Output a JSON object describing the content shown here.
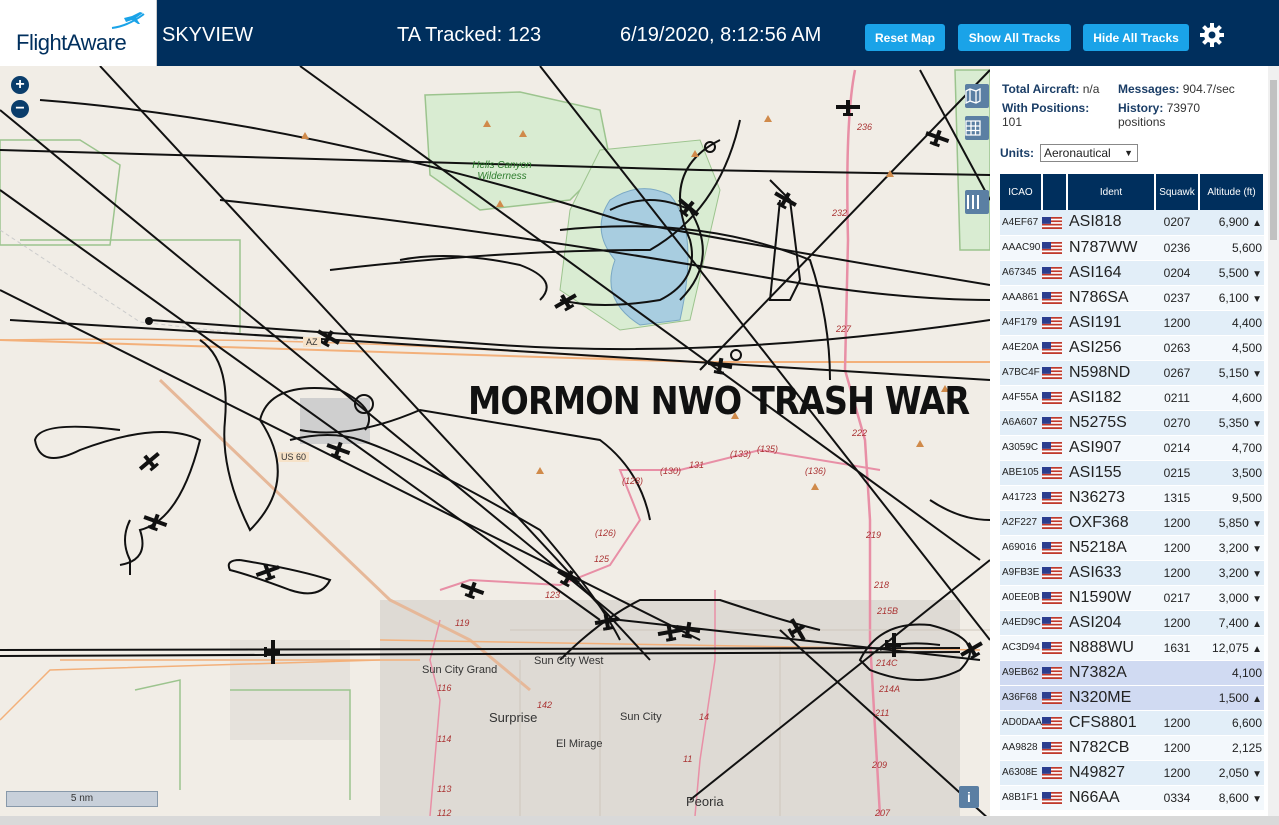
{
  "header": {
    "logo": "FlightAware",
    "app_name": "SKYVIEW",
    "tracked": "TA Tracked: 123",
    "datetime": "6/19/2020, 8:12:56 AM",
    "buttons": {
      "reset": "Reset Map",
      "show_all": "Show All Tracks",
      "hide_all": "Hide All Tracks"
    }
  },
  "map": {
    "overlay_text": "MORMON NWO TRASH WAR",
    "scale": "5 nm",
    "zoom_in": "+",
    "zoom_out": "−",
    "info": "i",
    "places": [
      "Hells Canyon",
      "Wilderness",
      "Sun City Grand",
      "Sun City West",
      "Surprise",
      "Sun City",
      "El Mirage",
      "Peoria",
      "AZ",
      "US 60"
    ],
    "route_labels": [
      "236",
      "232",
      "227",
      "222",
      "219",
      "218",
      "215B",
      "214C",
      "214A",
      "211",
      "209",
      "207",
      "131",
      "(133)",
      "(135)",
      "(136)",
      "(130)",
      "(128)",
      "(126)",
      "125",
      "123",
      "119",
      "116",
      "114",
      "113",
      "112",
      "142",
      "14",
      "11"
    ]
  },
  "panel": {
    "stats": {
      "total_aircraft_label": "Total Aircraft:",
      "total_aircraft": "n/a",
      "messages_label": "Messages:",
      "messages": "904.7/sec",
      "with_positions_label": "With Positions:",
      "with_positions": "101",
      "history_label": "History:",
      "history": "73970",
      "history_unit": "positions"
    },
    "units_label": "Units:",
    "units_value": "Aeronautical",
    "columns": [
      "ICAO",
      "",
      "Ident",
      "Squawk",
      "Altitude (ft)"
    ],
    "rows": [
      {
        "icao": "A4EF67",
        "ident": "ASI818",
        "squawk": "0207",
        "alt": "6,900",
        "trend": "▲",
        "pos": true
      },
      {
        "icao": "AAAC90",
        "ident": "N787WW",
        "squawk": "0236",
        "alt": "5,600",
        "trend": "",
        "pos": true
      },
      {
        "icao": "A67345",
        "ident": "ASI164",
        "squawk": "0204",
        "alt": "5,500",
        "trend": "▼",
        "pos": true
      },
      {
        "icao": "AAA861",
        "ident": "N786SA",
        "squawk": "0237",
        "alt": "6,100",
        "trend": "▼",
        "pos": true
      },
      {
        "icao": "A4F179",
        "ident": "ASI191",
        "squawk": "1200",
        "alt": "4,400",
        "trend": "",
        "pos": true
      },
      {
        "icao": "A4E20A",
        "ident": "ASI256",
        "squawk": "0263",
        "alt": "4,500",
        "trend": "",
        "pos": true
      },
      {
        "icao": "A7BC4F",
        "ident": "N598ND",
        "squawk": "0267",
        "alt": "5,150",
        "trend": "▼",
        "pos": true
      },
      {
        "icao": "A4F55A",
        "ident": "ASI182",
        "squawk": "0211",
        "alt": "4,600",
        "trend": "",
        "pos": true
      },
      {
        "icao": "A6A607",
        "ident": "N5275S",
        "squawk": "0270",
        "alt": "5,350",
        "trend": "▼",
        "pos": true
      },
      {
        "icao": "A3059C",
        "ident": "ASI907",
        "squawk": "0214",
        "alt": "4,700",
        "trend": "",
        "pos": true
      },
      {
        "icao": "ABE105",
        "ident": "ASI155",
        "squawk": "0215",
        "alt": "3,500",
        "trend": "",
        "pos": true
      },
      {
        "icao": "A41723",
        "ident": "N36273",
        "squawk": "1315",
        "alt": "9,500",
        "trend": "",
        "pos": true
      },
      {
        "icao": "A2F227",
        "ident": "OXF368",
        "squawk": "1200",
        "alt": "5,850",
        "trend": "▼",
        "pos": true
      },
      {
        "icao": "A69016",
        "ident": "N5218A",
        "squawk": "1200",
        "alt": "3,200",
        "trend": "▼",
        "pos": true
      },
      {
        "icao": "A9FB3E",
        "ident": "ASI633",
        "squawk": "1200",
        "alt": "3,200",
        "trend": "▼",
        "pos": true
      },
      {
        "icao": "A0EE0B",
        "ident": "N1590W",
        "squawk": "0217",
        "alt": "3,000",
        "trend": "▼",
        "pos": true
      },
      {
        "icao": "A4ED9C",
        "ident": "ASI204",
        "squawk": "1200",
        "alt": "7,400",
        "trend": "▲",
        "pos": true
      },
      {
        "icao": "AC3D94",
        "ident": "N888WU",
        "squawk": "1631",
        "alt": "12,075",
        "trend": "▲",
        "pos": true
      },
      {
        "icao": "A9EB62",
        "ident": "N7382A",
        "squawk": "",
        "alt": "4,100",
        "trend": "",
        "pos": false
      },
      {
        "icao": "A36F68",
        "ident": "N320ME",
        "squawk": "",
        "alt": "1,500",
        "trend": "▲",
        "pos": false
      },
      {
        "icao": "AD0DAA",
        "ident": "CFS8801",
        "squawk": "1200",
        "alt": "6,600",
        "trend": "",
        "pos": true
      },
      {
        "icao": "AA9828",
        "ident": "N782CB",
        "squawk": "1200",
        "alt": "2,125",
        "trend": "",
        "pos": true
      },
      {
        "icao": "A6308E",
        "ident": "N49827",
        "squawk": "1200",
        "alt": "2,050",
        "trend": "▼",
        "pos": true
      },
      {
        "icao": "A8B1F1",
        "ident": "N66AA",
        "squawk": "0334",
        "alt": "8,600",
        "trend": "▼",
        "pos": true
      }
    ]
  },
  "colors": {
    "header_bg": "#002f5d",
    "button": "#1aa3e8",
    "map_bg": "#f1ede6",
    "track": "#111111",
    "road": "#e88fa6",
    "highway": "#f3b07a"
  }
}
